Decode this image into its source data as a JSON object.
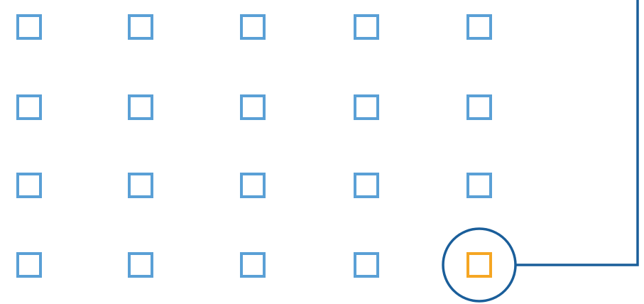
{
  "colors": {
    "cell_stroke": "#5aa0d6",
    "highlight_stroke": "#f5a623",
    "callout_stroke": "#1a5e9a",
    "background": "#ffffff"
  },
  "grid": {
    "rows": 4,
    "columns": 5,
    "highlighted_cell": {
      "row": 4,
      "column": 5
    }
  },
  "callout": {
    "shape": "circle",
    "connector": "elbow-line-to-top-right"
  }
}
